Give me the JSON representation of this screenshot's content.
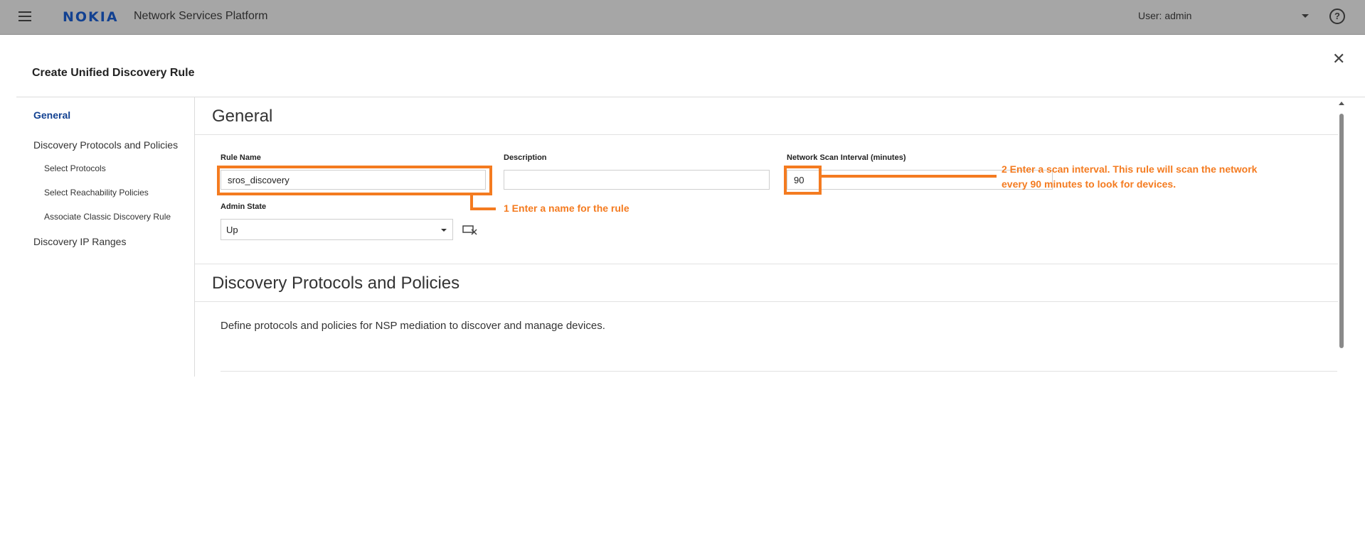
{
  "topbar": {
    "logo": "NOKIA",
    "app_title": "Network Services Platform",
    "user_label": "User: admin"
  },
  "dialog": {
    "title": "Create Unified Discovery Rule"
  },
  "nav": {
    "items": [
      {
        "label": "General"
      },
      {
        "label": "Discovery Protocols and Policies"
      },
      {
        "label": "Select Protocols"
      },
      {
        "label": "Select Reachability Policies"
      },
      {
        "label": "Associate Classic Discovery Rule"
      },
      {
        "label": "Discovery IP Ranges"
      }
    ]
  },
  "general": {
    "heading": "General",
    "rule_name": {
      "label": "Rule Name",
      "value": "sros_discovery"
    },
    "description": {
      "label": "Description",
      "value": ""
    },
    "scan_interval": {
      "label": "Network Scan Interval (minutes)",
      "value": "90"
    },
    "admin_state": {
      "label": "Admin State",
      "value": "Up"
    }
  },
  "protocols": {
    "heading": "Discovery Protocols and Policies",
    "description": "Define protocols and policies for NSP mediation to discover and manage devices."
  },
  "annotations": {
    "callout1": "1 Enter a name for the rule",
    "callout2_line1": "2 Enter a scan interval. This rule will scan the network",
    "callout2_line2": "every 90 minutes to look for devices.",
    "color": "#f47b20"
  },
  "colors": {
    "topbar": "#a6a6a6",
    "brand": "#124191",
    "active_nav": "#124191"
  }
}
